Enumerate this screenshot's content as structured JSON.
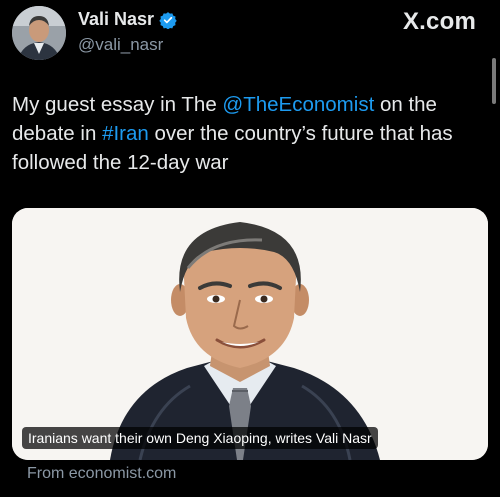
{
  "brand": "X.com",
  "author": {
    "display_name": "Vali Nasr",
    "handle": "@vali_nasr",
    "verified_icon": "verified-badge-icon",
    "avatar_icon": "avatar"
  },
  "tweet": {
    "part1": "My guest essay in The ",
    "mention": "@TheEconomist",
    "part2": " on the debate in ",
    "hashtag": "#Iran",
    "part3": " over the country’s future that has followed the 12-day war"
  },
  "card": {
    "caption": "Iranians want their own Deng Xiaoping, writes Vali Nasr",
    "source": "From economist.com"
  },
  "colors": {
    "background": "#000000",
    "text": "#e7e9ea",
    "secondary": "#8b98a5",
    "link": "#1d9bf0"
  }
}
